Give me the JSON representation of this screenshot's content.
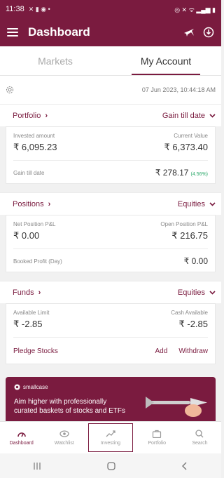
{
  "status": {
    "time": "11:38",
    "left_icons": "✕ ▮ ◉ •",
    "right_icons": "◎ ✕ ᯤ ▂▄▆ ▮"
  },
  "appbar": {
    "title": "Dashboard"
  },
  "tabs": [
    {
      "label": "Markets"
    },
    {
      "label": "My Account"
    }
  ],
  "datebar": {
    "date": "07 Jun 2023, 10:44:18 AM"
  },
  "portfolio": {
    "label": "Portfolio",
    "filter": "Gain till date",
    "invested_label": "Invested amount",
    "invested_value": "₹ 6,095.23",
    "current_label": "Current Value",
    "current_value": "₹ 6,373.40",
    "gain_label": "Gain till date",
    "gain_value": "₹ 278.17",
    "gain_pct": "(4.56%)"
  },
  "positions": {
    "label": "Positions",
    "filter": "Equities",
    "net_label": "Net Position P&L",
    "net_value": "₹ 0.00",
    "open_label": "Open Position P&L",
    "open_value": "₹ 216.75",
    "booked_label": "Booked Profit (Day)",
    "booked_value": "₹ 0.00"
  },
  "funds": {
    "label": "Funds",
    "filter": "Equities",
    "avail_label": "Available Limit",
    "avail_value": "₹ -2.85",
    "cash_label": "Cash Available",
    "cash_value": "₹ -2.85",
    "pledge_label": "Pledge Stocks",
    "add_label": "Add",
    "withdraw_label": "Withdraw"
  },
  "banner": {
    "brand": "smallcase",
    "tagline": "Aim higher with professionally curated baskets of stocks and ETFs"
  },
  "bottomnav": [
    {
      "label": "Dashboard",
      "icon": "dashboard-icon"
    },
    {
      "label": "Watchlist",
      "icon": "eye-icon"
    },
    {
      "label": "Investing",
      "icon": "trend-icon"
    },
    {
      "label": "Portfolio",
      "icon": "briefcase-icon"
    },
    {
      "label": "Search",
      "icon": "search-icon"
    }
  ],
  "colors": {
    "brand": "#7a1b3f",
    "positive": "#2aa869"
  }
}
